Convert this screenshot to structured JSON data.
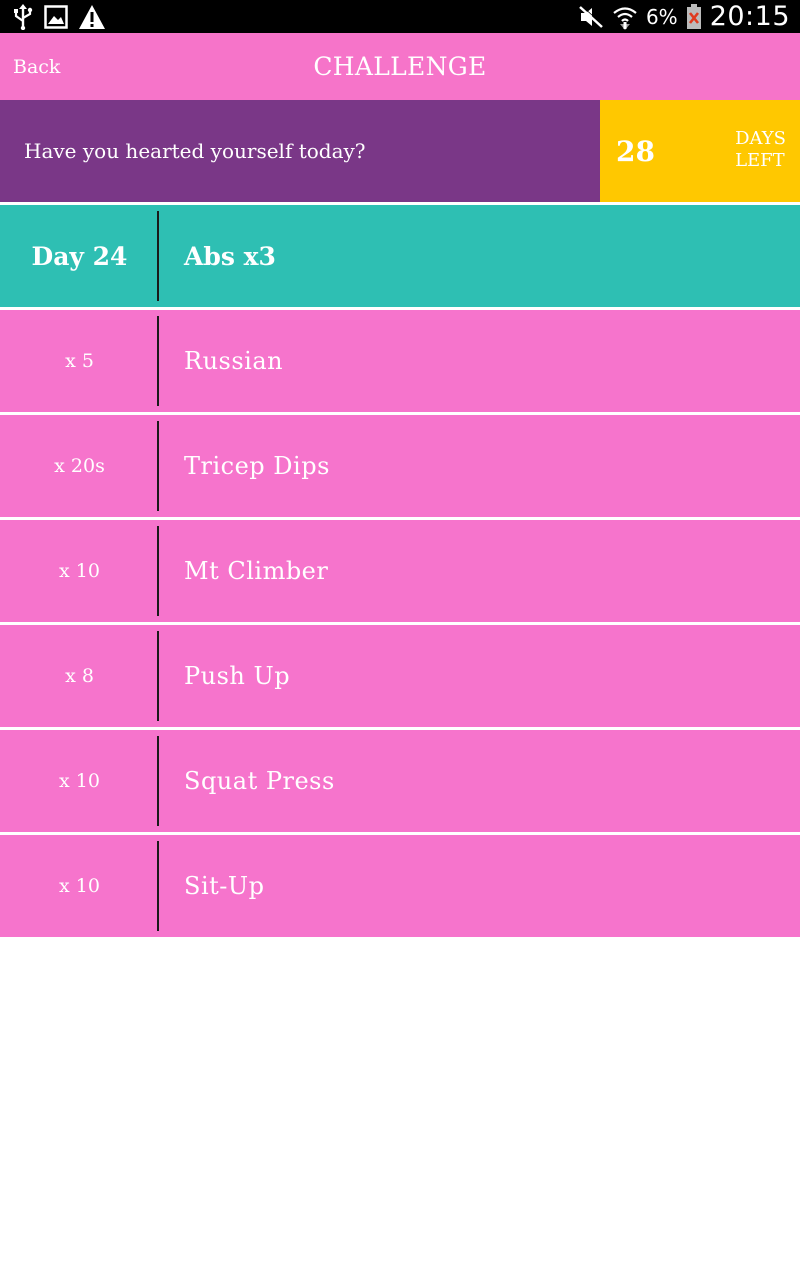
{
  "status_bar": {
    "icons_left": [
      "usb-icon",
      "image-icon",
      "warning-icon"
    ],
    "icons_right": [
      "mute-icon",
      "wifi-icon",
      "battery-icon"
    ],
    "battery_percent": "6%",
    "time": "20:15"
  },
  "header": {
    "back_label": "Back",
    "title": "CHALLENGE",
    "background": "#f674c9"
  },
  "banner": {
    "prompt": "Have you hearted yourself today?",
    "days_count": "28",
    "days_label_line1": "DAYS",
    "days_label_line2": "LEFT",
    "prompt_color": "#7a3787",
    "days_color": "#ffc800"
  },
  "workout": {
    "day_label": "Day 24",
    "title": "Abs x3",
    "day_color": "#2ebfb3",
    "item_color": "#f674cc",
    "items": [
      {
        "reps": "x 5",
        "name": "Russian"
      },
      {
        "reps": "x 20s",
        "name": "Tricep Dips"
      },
      {
        "reps": "x 10",
        "name": "Mt Climber"
      },
      {
        "reps": "x 8",
        "name": "Push Up"
      },
      {
        "reps": "x 10",
        "name": "Squat Press"
      },
      {
        "reps": "x 10",
        "name": "Sit-Up"
      }
    ]
  }
}
